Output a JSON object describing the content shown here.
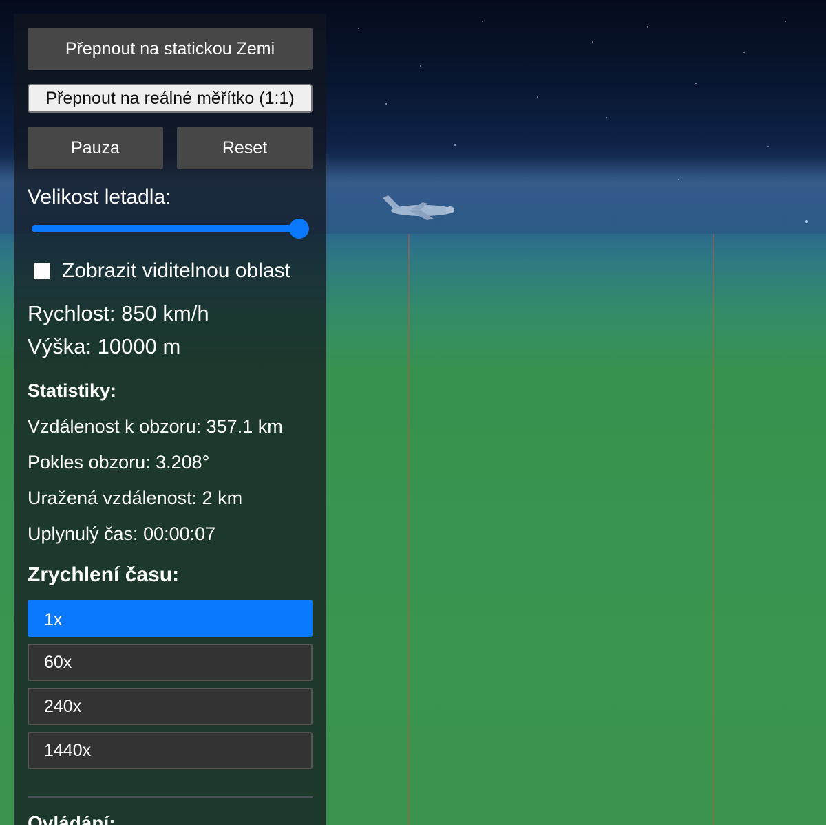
{
  "panel": {
    "static_earth_button": "Přepnout na statickou Zemi",
    "real_scale_button": "Přepnout na reálné měřítko (1:1)",
    "pause_button": "Pauza",
    "reset_button": "Reset",
    "plane_size_label": "Velikost letadla:",
    "plane_size_slider_value": 1.0,
    "show_visible_area_label": "Zobrazit viditelnou oblast",
    "show_visible_area_checked": false,
    "speed": "Rychlost: 850 km/h",
    "altitude": "Výška: 10000 m",
    "stats_heading": "Statistiky:",
    "stats": {
      "horizon_distance": "Vzdálenost k obzoru: 357.1 km",
      "horizon_drop": "Pokles obzoru: 3.208°",
      "distance_traveled": "Uražená vzdálenost: 2 km",
      "elapsed_time": "Uplynulý čas: 00:00:07"
    },
    "time_accel_heading": "Zrychlení času:",
    "time_accel_options": [
      "1x",
      "60x",
      "240x",
      "1440x"
    ],
    "time_accel_selected": "1x",
    "controls_heading": "Ovládání:"
  },
  "scene": {
    "icons": [
      "airplane-icon",
      "star-icons"
    ],
    "colors": {
      "accent": "#0a78ff",
      "ground": "#399550",
      "sky": "#081630"
    }
  }
}
